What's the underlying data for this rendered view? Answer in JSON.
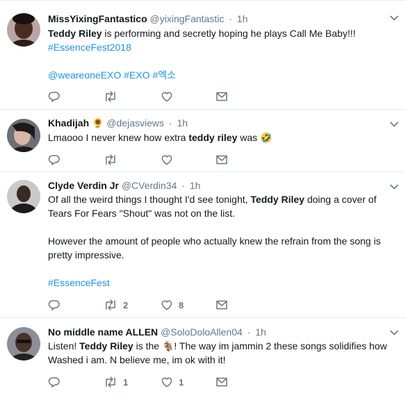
{
  "tweets": [
    {
      "name": "MissYixingFantastico",
      "handle": "@yixingFantastic",
      "time": "1h",
      "text": {
        "t1_bold": "Teddy Riley",
        "t1_rest": " is performing and secretly hoping he plays Call Me Baby!!!",
        "t1_tag": "#EssenceFest2018",
        "t2_mention": "@weareoneEXO",
        "t2_tag1": "#EXO",
        "t2_tag2": "#엑소"
      },
      "replies": "",
      "retweets": "",
      "likes": ""
    },
    {
      "name": "Khadijah",
      "name_emoji": "🌻",
      "handle": "@dejasviews",
      "time": "1h",
      "text": {
        "p1": "Lmaooo I never knew how extra ",
        "bold": "teddy riley",
        "p2": " was ",
        "emoji": "🤣"
      },
      "replies": "",
      "retweets": "",
      "likes": ""
    },
    {
      "name": "Clyde Verdin Jr",
      "handle": "@CVerdin34",
      "time": "1h",
      "text": {
        "p1a": "Of all the weird things I thought I'd see tonight, ",
        "p1bold": "Teddy Riley",
        "p1b": " doing a cover of Tears For Fears \"Shout\" was not on the list.",
        "p2": "However the amount of people who actually knew the refrain from the song is pretty impressive.",
        "tag": "#EssenceFest"
      },
      "replies": "",
      "retweets": "2",
      "likes": "8"
    },
    {
      "name": "No middle name ALLEN",
      "handle": "@SoloDoloAllen04",
      "time": "1h",
      "text": {
        "p1": "Listen! ",
        "bold": "Teddy Riley",
        "p2": " is the ",
        "emoji": "🐐",
        "p3": "! The way im jammin 2 these songs solidifies how Washed i am. N believe me, im ok with it!"
      },
      "replies": "",
      "retweets": "1",
      "likes": "1"
    }
  ],
  "separator": "·",
  "colors": {
    "link": "#1b95e0",
    "muted": "#657786",
    "text": "#14171a",
    "border": "#e6ecf0"
  },
  "icons": [
    "reply-icon",
    "retweet-icon",
    "like-icon",
    "direct-message-icon",
    "caret-down-icon"
  ]
}
